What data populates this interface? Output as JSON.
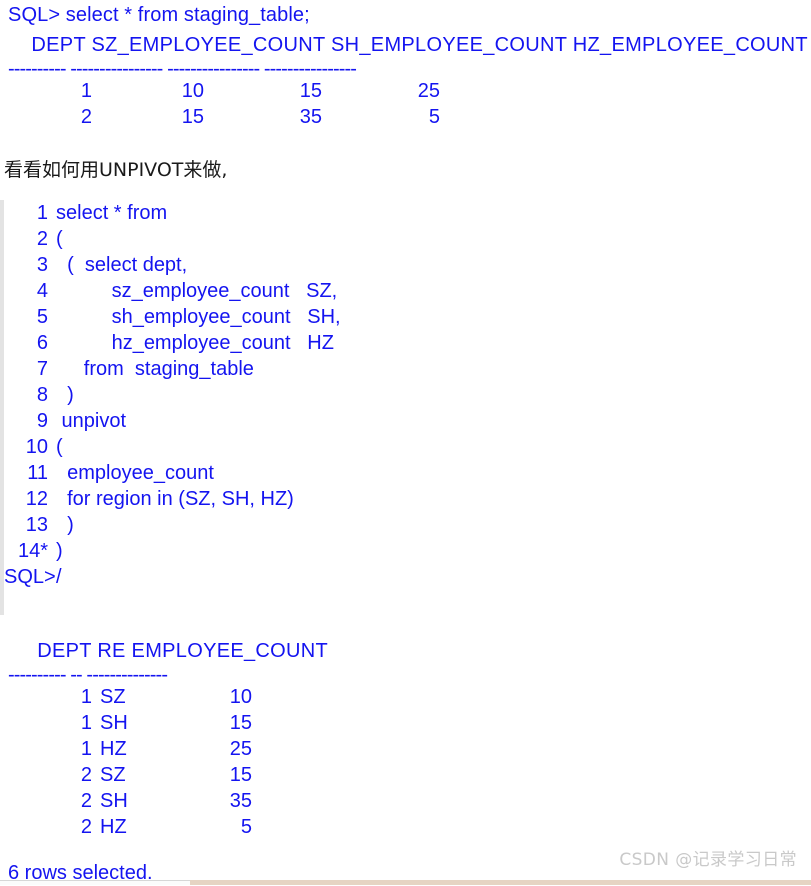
{
  "colors": {
    "terminal_text": "#1414f0",
    "note_text": "#1a1a1a",
    "watermark": "#c9c9c9",
    "gutter_rule": "#e3e3e3",
    "bottom_strip": "#e6d4c3",
    "background": "#ffffff"
  },
  "block_one": {
    "prompt": "SQL> select * from staging_table;",
    "header": "    DEPT SZ_EMPLOYEE_COUNT SH_EMPLOYEE_COUNT HZ_EMPLOYEE_COUNT",
    "rule": "---------- ---------------- ---------------- ----------------",
    "columns": [
      "DEPT",
      "SZ_EMPLOYEE_COUNT",
      "SH_EMPLOYEE_COUNT",
      "HZ_EMPLOYEE_COUNT"
    ],
    "rows": [
      [
        "1",
        "10",
        "15",
        "25"
      ],
      [
        "2",
        "15",
        "35",
        "5"
      ]
    ]
  },
  "note": {
    "text": "看看如何用UNPIVOT来做,"
  },
  "code_block": {
    "lines": [
      {
        "num": "1",
        "text": "select * from"
      },
      {
        "num": "2",
        "text": "("
      },
      {
        "num": "3",
        "text": "  (  select dept,"
      },
      {
        "num": "4",
        "text": "          sz_employee_count   SZ,"
      },
      {
        "num": "5",
        "text": "          sh_employee_count   SH,"
      },
      {
        "num": "6",
        "text": "          hz_employee_count   HZ"
      },
      {
        "num": "7",
        "text": "     from  staging_table"
      },
      {
        "num": "8",
        "text": "  )"
      },
      {
        "num": "9",
        "text": " unpivot"
      },
      {
        "num": "10",
        "text": "("
      },
      {
        "num": "11",
        "text": "  employee_count"
      },
      {
        "num": "12",
        "text": "  for region in (SZ, SH, HZ)"
      },
      {
        "num": "13",
        "text": "  )"
      },
      {
        "num": "14*",
        "text": ")"
      },
      {
        "num": "SQL>",
        "text": "/"
      }
    ]
  },
  "block_two": {
    "header": "     DEPT RE EMPLOYEE_COUNT",
    "rule": "---------- -- --------------",
    "columns": [
      "DEPT",
      "RE",
      "EMPLOYEE_COUNT"
    ],
    "rows": [
      [
        "1",
        "SZ",
        "10"
      ],
      [
        "1",
        "SH",
        "15"
      ],
      [
        "1",
        "HZ",
        "25"
      ],
      [
        "2",
        "SZ",
        "15"
      ],
      [
        "2",
        "SH",
        "35"
      ],
      [
        "2",
        "HZ",
        "5"
      ]
    ],
    "footer": "6 rows selected."
  },
  "watermark": {
    "text": "CSDN @记录学习日常"
  }
}
